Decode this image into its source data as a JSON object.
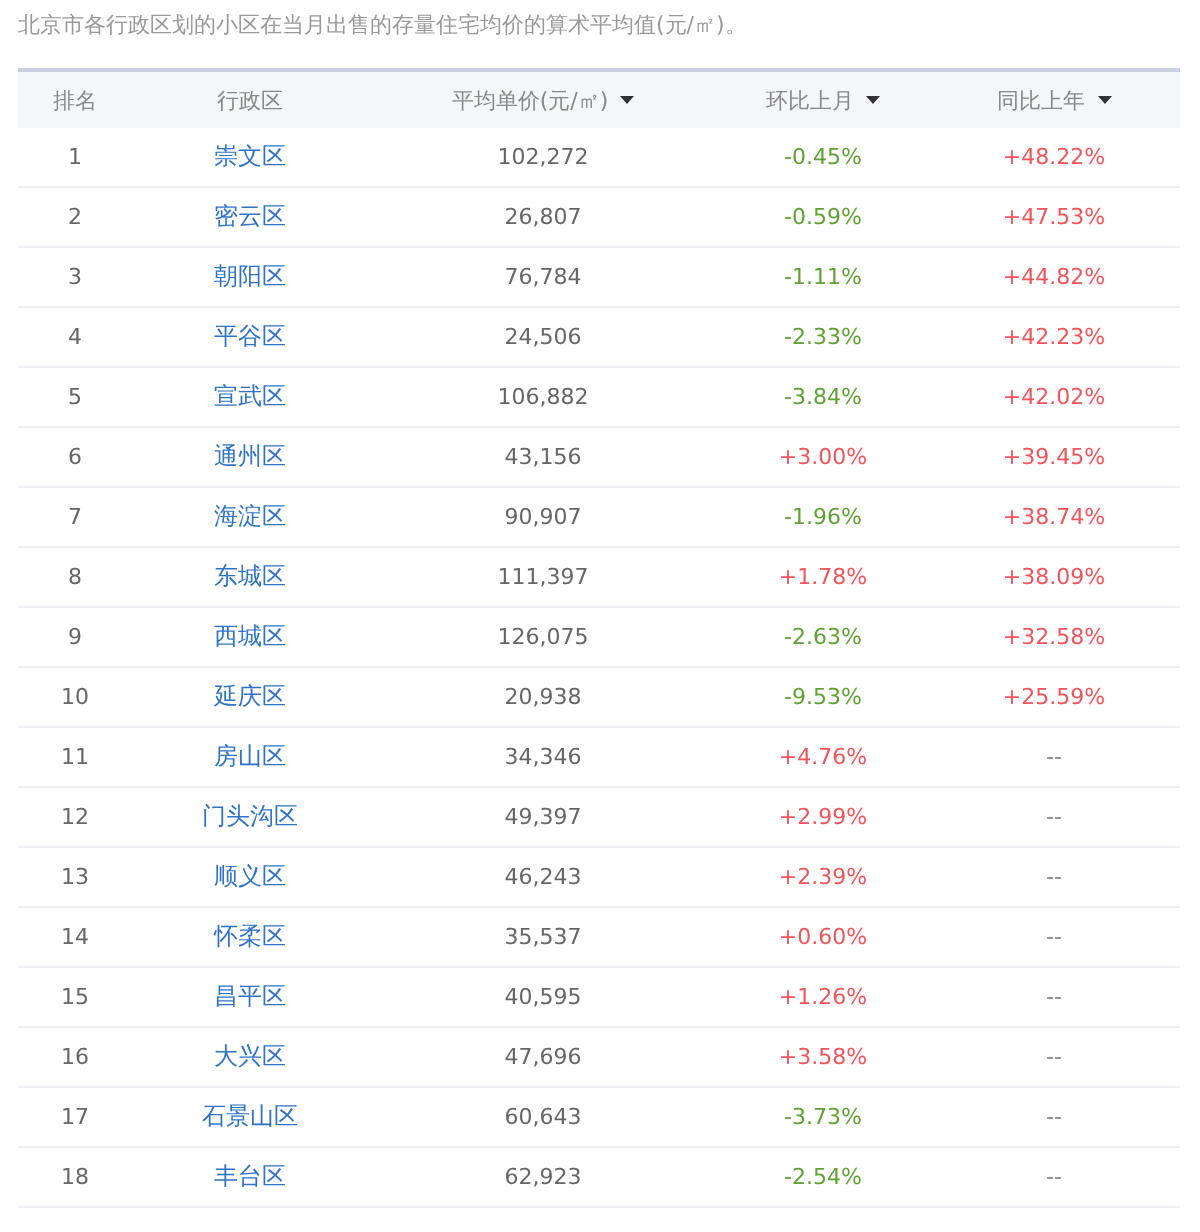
{
  "caption": "北京市各行政区划的小区在当月出售的存量住宅均价的算术平均值(元/㎡)。",
  "columns": [
    {
      "label": "排名",
      "sortable": false
    },
    {
      "label": "行政区",
      "sortable": false
    },
    {
      "label": "平均单价(元/㎡)",
      "sortable": true
    },
    {
      "label": "环比上月",
      "sortable": true
    },
    {
      "label": "同比上年",
      "sortable": true
    }
  ],
  "rows": [
    {
      "rank": "1",
      "district": "崇文区",
      "price": "102,272",
      "mom": {
        "text": "-0.45%",
        "color": "#5fa233"
      },
      "yoy": {
        "text": "+48.22%",
        "color": "#f2545b"
      }
    },
    {
      "rank": "2",
      "district": "密云区",
      "price": "26,807",
      "mom": {
        "text": "-0.59%",
        "color": "#5fa233"
      },
      "yoy": {
        "text": "+47.53%",
        "color": "#f2545b"
      }
    },
    {
      "rank": "3",
      "district": "朝阳区",
      "price": "76,784",
      "mom": {
        "text": "-1.11%",
        "color": "#5fa233"
      },
      "yoy": {
        "text": "+44.82%",
        "color": "#f2545b"
      }
    },
    {
      "rank": "4",
      "district": "平谷区",
      "price": "24,506",
      "mom": {
        "text": "-2.33%",
        "color": "#5fa233"
      },
      "yoy": {
        "text": "+42.23%",
        "color": "#f2545b"
      }
    },
    {
      "rank": "5",
      "district": "宣武区",
      "price": "106,882",
      "mom": {
        "text": "-3.84%",
        "color": "#5fa233"
      },
      "yoy": {
        "text": "+42.02%",
        "color": "#f2545b"
      }
    },
    {
      "rank": "6",
      "district": "通州区",
      "price": "43,156",
      "mom": {
        "text": "+3.00%",
        "color": "#f2545b"
      },
      "yoy": {
        "text": "+39.45%",
        "color": "#f2545b"
      }
    },
    {
      "rank": "7",
      "district": "海淀区",
      "price": "90,907",
      "mom": {
        "text": "-1.96%",
        "color": "#5fa233"
      },
      "yoy": {
        "text": "+38.74%",
        "color": "#f2545b"
      }
    },
    {
      "rank": "8",
      "district": "东城区",
      "price": "111,397",
      "mom": {
        "text": "+1.78%",
        "color": "#f2545b"
      },
      "yoy": {
        "text": "+38.09%",
        "color": "#f2545b"
      }
    },
    {
      "rank": "9",
      "district": "西城区",
      "price": "126,075",
      "mom": {
        "text": "-2.63%",
        "color": "#5fa233"
      },
      "yoy": {
        "text": "+32.58%",
        "color": "#f2545b"
      }
    },
    {
      "rank": "10",
      "district": "延庆区",
      "price": "20,938",
      "mom": {
        "text": "-9.53%",
        "color": "#5fa233"
      },
      "yoy": {
        "text": "+25.59%",
        "color": "#f2545b"
      }
    },
    {
      "rank": "11",
      "district": "房山区",
      "price": "34,346",
      "mom": {
        "text": "+4.76%",
        "color": "#f2545b"
      },
      "yoy": {
        "text": "--",
        "color": "#888888"
      }
    },
    {
      "rank": "12",
      "district": "门头沟区",
      "price": "49,397",
      "mom": {
        "text": "+2.99%",
        "color": "#f2545b"
      },
      "yoy": {
        "text": "--",
        "color": "#888888"
      }
    },
    {
      "rank": "13",
      "district": "顺义区",
      "price": "46,243",
      "mom": {
        "text": "+2.39%",
        "color": "#f2545b"
      },
      "yoy": {
        "text": "--",
        "color": "#888888"
      }
    },
    {
      "rank": "14",
      "district": "怀柔区",
      "price": "35,537",
      "mom": {
        "text": "+0.60%",
        "color": "#f2545b"
      },
      "yoy": {
        "text": "--",
        "color": "#888888"
      }
    },
    {
      "rank": "15",
      "district": "昌平区",
      "price": "40,595",
      "mom": {
        "text": "+1.26%",
        "color": "#f2545b"
      },
      "yoy": {
        "text": "--",
        "color": "#888888"
      }
    },
    {
      "rank": "16",
      "district": "大兴区",
      "price": "47,696",
      "mom": {
        "text": "+3.58%",
        "color": "#f2545b"
      },
      "yoy": {
        "text": "--",
        "color": "#888888"
      }
    },
    {
      "rank": "17",
      "district": "石景山区",
      "price": "60,643",
      "mom": {
        "text": "-3.73%",
        "color": "#5fa233"
      },
      "yoy": {
        "text": "--",
        "color": "#888888"
      }
    },
    {
      "rank": "18",
      "district": "丰台区",
      "price": "62,923",
      "mom": {
        "text": "-2.54%",
        "color": "#5fa233"
      },
      "yoy": {
        "text": "--",
        "color": "#888888"
      }
    }
  ]
}
